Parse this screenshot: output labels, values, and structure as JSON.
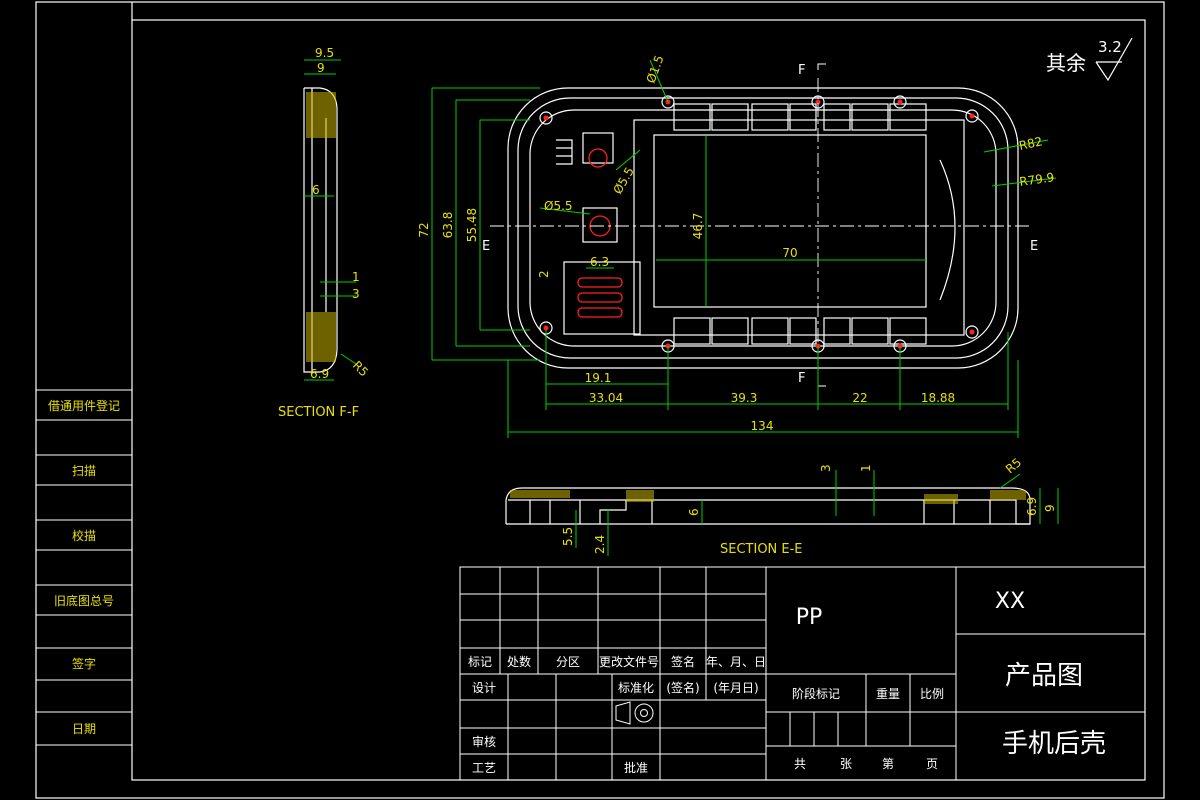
{
  "drawing": {
    "roughness_note": {
      "label": "其余",
      "value": "3.2"
    },
    "sections": {
      "ff": "SECTION F-F",
      "ee": "SECTION E-E"
    },
    "cut_marks": {
      "f_top": "F",
      "f_bottom": "F",
      "e_left": "E",
      "e_right": "E"
    },
    "dims_ff": {
      "d95": "9.5",
      "d9": "9",
      "d6": "6",
      "d1": "1",
      "d3": "3",
      "d69": "6.9",
      "r5": "R5"
    },
    "dims_main": {
      "h72": "72",
      "h638": "63.8",
      "h5548": "55.48",
      "h467": "46.7",
      "w70": "70",
      "d15": "Ø1.5",
      "d55a": "Ø5.5",
      "d55b": "Ø5.5",
      "r82": "R82",
      "r799": "R79.9",
      "d63": "6.3",
      "d2": "2",
      "d191": "19.1",
      "d3304": "33.04",
      "d393": "39.3",
      "d22": "22",
      "d1888": "18.88",
      "d134": "134"
    },
    "dims_ee": {
      "d3": "3",
      "d1": "1",
      "d6": "6",
      "d55": "5.5",
      "d24": "2.4",
      "r5": "R5",
      "d69": "6.9",
      "d9": "9"
    }
  },
  "side_panel": {
    "items": [
      "借通用件登记",
      "扫描",
      "校描",
      "旧底图总号",
      "签字",
      "日期"
    ]
  },
  "title_block": {
    "material": "PP",
    "company": "XX",
    "drawing_type": "产品图",
    "part_name": "手机后壳",
    "row_headers": [
      "标记",
      "处数",
      "分区",
      "更改文件号",
      "签名",
      "年、月、日"
    ],
    "design": "设计",
    "standardize": "标准化",
    "sign_paren": "(签名)",
    "date_paren": "(年月日)",
    "review": "审核",
    "process": "工艺",
    "approve": "批准",
    "stage_mark": "阶段标记",
    "weight": "重量",
    "scale": "比例",
    "total": "共",
    "sheets": "张",
    "num": "第",
    "page": "页"
  },
  "colors": {
    "frame": "#ffffff",
    "part": "#ffffff",
    "dimension": "#00d000",
    "text": "#e8e000",
    "red": "#ff2020",
    "center": "#ffffff"
  }
}
